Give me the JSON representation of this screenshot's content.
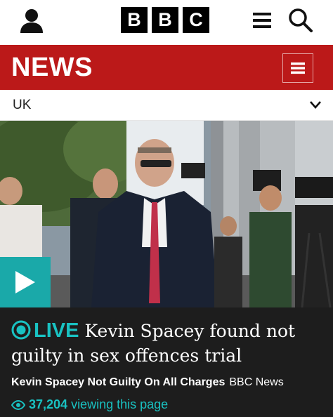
{
  "header": {
    "logo_letters": [
      "B",
      "B",
      "C"
    ],
    "icons": {
      "account": "person-icon",
      "menu": "hamburger-menu-icon",
      "search": "search-icon"
    }
  },
  "news_bar": {
    "title": "NEWS",
    "background": "#bb1919",
    "menu_icon": "list-menu-icon"
  },
  "section": {
    "label": "UK",
    "chevron_icon": "chevron-down-icon"
  },
  "hero": {
    "play_icon": "play-icon",
    "accent": "#1aa9a9"
  },
  "article": {
    "live_label": "LIVE",
    "headline": "Kevin Spacey found not guilty in sex offences trial",
    "summary_title": "Kevin Spacey Not Guilty On All Charges",
    "source": "BBC News",
    "viewer_count": "37,204",
    "viewer_text": "viewing this page",
    "live_color": "#19c2c2"
  }
}
